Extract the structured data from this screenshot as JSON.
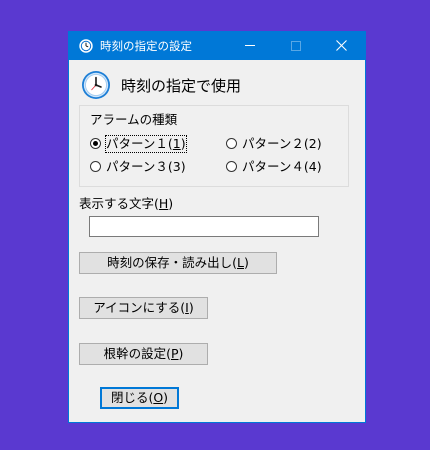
{
  "window": {
    "title": "時刻の指定の設定",
    "header_title": "時刻の指定で使用",
    "alarm_group": {
      "legend": "アラームの種類",
      "options": [
        {
          "label": "パターン１(",
          "mnemonic": "1",
          "suffix": ")",
          "selected": true
        },
        {
          "label": "パターン２(2)",
          "selected": false
        },
        {
          "label": "パターン３(3)",
          "selected": false
        },
        {
          "label": "パターン４(4)",
          "selected": false
        }
      ]
    },
    "display_text": {
      "label": "表示する文字(",
      "mnemonic": "H",
      "suffix": ")",
      "value": ""
    },
    "buttons": {
      "save_load": {
        "label": "時刻の保存・読み出し(",
        "mnemonic": "L",
        "suffix": ")"
      },
      "icon": {
        "label": "アイコンにする(",
        "mnemonic": "I",
        "suffix": ")"
      },
      "root_settings": {
        "label": "根幹の設定(",
        "mnemonic": "P",
        "suffix": ")"
      },
      "close": {
        "label": "閉じる(",
        "mnemonic": "O",
        "suffix": ")"
      }
    }
  },
  "colors": {
    "desktop": "#5a39d0",
    "titlebar": "#0078d7",
    "window_bg": "#f0f0f0",
    "button_face": "#e1e1e1"
  },
  "icons": [
    "clock-icon",
    "minimize-icon",
    "maximize-icon",
    "close-icon"
  ]
}
